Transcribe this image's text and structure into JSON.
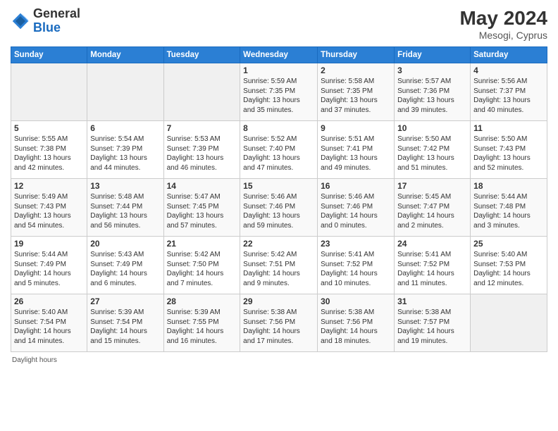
{
  "header": {
    "logo_general": "General",
    "logo_blue": "Blue",
    "month_year": "May 2024",
    "location": "Mesogi, Cyprus"
  },
  "days_of_week": [
    "Sunday",
    "Monday",
    "Tuesday",
    "Wednesday",
    "Thursday",
    "Friday",
    "Saturday"
  ],
  "weeks": [
    [
      {
        "day": "",
        "info": ""
      },
      {
        "day": "",
        "info": ""
      },
      {
        "day": "",
        "info": ""
      },
      {
        "day": "1",
        "info": "Sunrise: 5:59 AM\nSunset: 7:35 PM\nDaylight: 13 hours\nand 35 minutes."
      },
      {
        "day": "2",
        "info": "Sunrise: 5:58 AM\nSunset: 7:35 PM\nDaylight: 13 hours\nand 37 minutes."
      },
      {
        "day": "3",
        "info": "Sunrise: 5:57 AM\nSunset: 7:36 PM\nDaylight: 13 hours\nand 39 minutes."
      },
      {
        "day": "4",
        "info": "Sunrise: 5:56 AM\nSunset: 7:37 PM\nDaylight: 13 hours\nand 40 minutes."
      }
    ],
    [
      {
        "day": "5",
        "info": "Sunrise: 5:55 AM\nSunset: 7:38 PM\nDaylight: 13 hours\nand 42 minutes."
      },
      {
        "day": "6",
        "info": "Sunrise: 5:54 AM\nSunset: 7:39 PM\nDaylight: 13 hours\nand 44 minutes."
      },
      {
        "day": "7",
        "info": "Sunrise: 5:53 AM\nSunset: 7:39 PM\nDaylight: 13 hours\nand 46 minutes."
      },
      {
        "day": "8",
        "info": "Sunrise: 5:52 AM\nSunset: 7:40 PM\nDaylight: 13 hours\nand 47 minutes."
      },
      {
        "day": "9",
        "info": "Sunrise: 5:51 AM\nSunset: 7:41 PM\nDaylight: 13 hours\nand 49 minutes."
      },
      {
        "day": "10",
        "info": "Sunrise: 5:50 AM\nSunset: 7:42 PM\nDaylight: 13 hours\nand 51 minutes."
      },
      {
        "day": "11",
        "info": "Sunrise: 5:50 AM\nSunset: 7:43 PM\nDaylight: 13 hours\nand 52 minutes."
      }
    ],
    [
      {
        "day": "12",
        "info": "Sunrise: 5:49 AM\nSunset: 7:43 PM\nDaylight: 13 hours\nand 54 minutes."
      },
      {
        "day": "13",
        "info": "Sunrise: 5:48 AM\nSunset: 7:44 PM\nDaylight: 13 hours\nand 56 minutes."
      },
      {
        "day": "14",
        "info": "Sunrise: 5:47 AM\nSunset: 7:45 PM\nDaylight: 13 hours\nand 57 minutes."
      },
      {
        "day": "15",
        "info": "Sunrise: 5:46 AM\nSunset: 7:46 PM\nDaylight: 13 hours\nand 59 minutes."
      },
      {
        "day": "16",
        "info": "Sunrise: 5:46 AM\nSunset: 7:46 PM\nDaylight: 14 hours\nand 0 minutes."
      },
      {
        "day": "17",
        "info": "Sunrise: 5:45 AM\nSunset: 7:47 PM\nDaylight: 14 hours\nand 2 minutes."
      },
      {
        "day": "18",
        "info": "Sunrise: 5:44 AM\nSunset: 7:48 PM\nDaylight: 14 hours\nand 3 minutes."
      }
    ],
    [
      {
        "day": "19",
        "info": "Sunrise: 5:44 AM\nSunset: 7:49 PM\nDaylight: 14 hours\nand 5 minutes."
      },
      {
        "day": "20",
        "info": "Sunrise: 5:43 AM\nSunset: 7:49 PM\nDaylight: 14 hours\nand 6 minutes."
      },
      {
        "day": "21",
        "info": "Sunrise: 5:42 AM\nSunset: 7:50 PM\nDaylight: 14 hours\nand 7 minutes."
      },
      {
        "day": "22",
        "info": "Sunrise: 5:42 AM\nSunset: 7:51 PM\nDaylight: 14 hours\nand 9 minutes."
      },
      {
        "day": "23",
        "info": "Sunrise: 5:41 AM\nSunset: 7:52 PM\nDaylight: 14 hours\nand 10 minutes."
      },
      {
        "day": "24",
        "info": "Sunrise: 5:41 AM\nSunset: 7:52 PM\nDaylight: 14 hours\nand 11 minutes."
      },
      {
        "day": "25",
        "info": "Sunrise: 5:40 AM\nSunset: 7:53 PM\nDaylight: 14 hours\nand 12 minutes."
      }
    ],
    [
      {
        "day": "26",
        "info": "Sunrise: 5:40 AM\nSunset: 7:54 PM\nDaylight: 14 hours\nand 14 minutes."
      },
      {
        "day": "27",
        "info": "Sunrise: 5:39 AM\nSunset: 7:54 PM\nDaylight: 14 hours\nand 15 minutes."
      },
      {
        "day": "28",
        "info": "Sunrise: 5:39 AM\nSunset: 7:55 PM\nDaylight: 14 hours\nand 16 minutes."
      },
      {
        "day": "29",
        "info": "Sunrise: 5:38 AM\nSunset: 7:56 PM\nDaylight: 14 hours\nand 17 minutes."
      },
      {
        "day": "30",
        "info": "Sunrise: 5:38 AM\nSunset: 7:56 PM\nDaylight: 14 hours\nand 18 minutes."
      },
      {
        "day": "31",
        "info": "Sunrise: 5:38 AM\nSunset: 7:57 PM\nDaylight: 14 hours\nand 19 minutes."
      },
      {
        "day": "",
        "info": ""
      }
    ]
  ],
  "footer": {
    "daylight_hours": "Daylight hours"
  }
}
